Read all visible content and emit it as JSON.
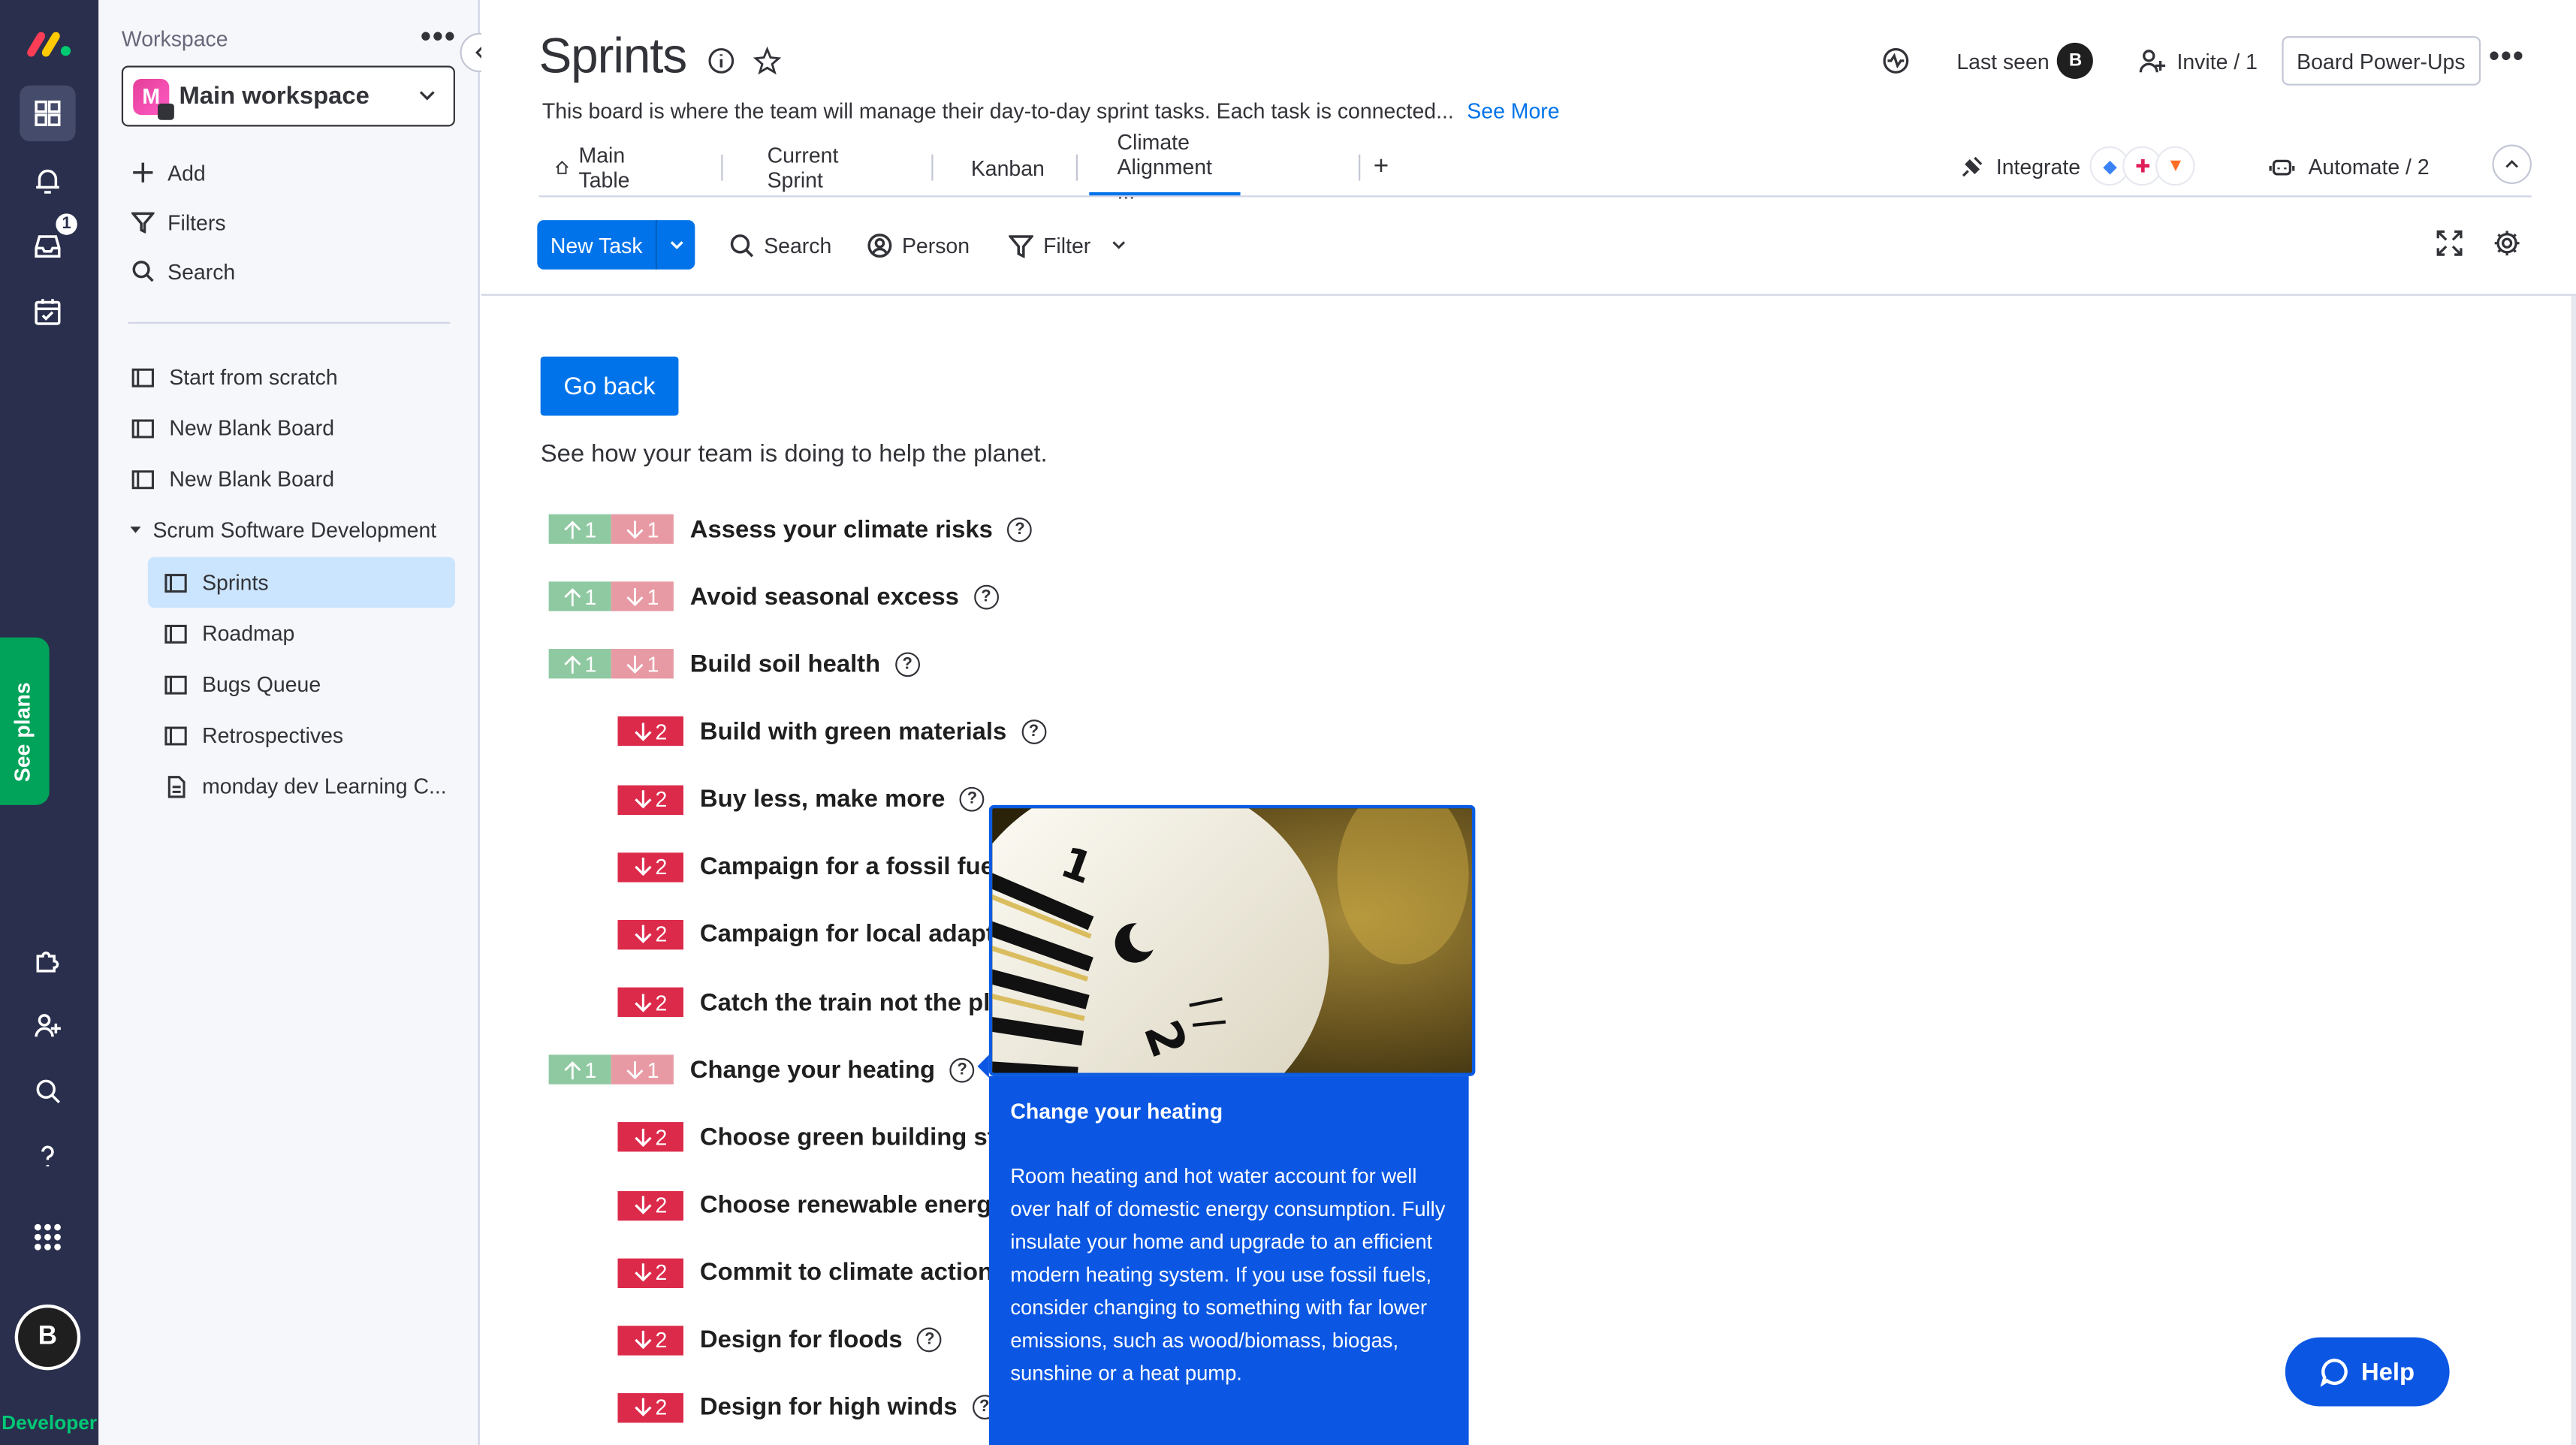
{
  "rail": {
    "inbox_badge": "1",
    "see_plans": "See plans",
    "avatar_initial": "B",
    "developer": "Developer"
  },
  "workspace": {
    "label": "Workspace",
    "name": "Main workspace",
    "icon_letter": "M",
    "actions": [
      "Add",
      "Filters",
      "Search"
    ],
    "items": [
      "Start from scratch",
      "New Blank Board",
      "New Blank Board"
    ],
    "folder": "Scrum Software Development",
    "folder_items": [
      "Sprints",
      "Roadmap",
      "Bugs Queue",
      "Retrospectives",
      "monday dev Learning C..."
    ]
  },
  "header": {
    "title": "Sprints",
    "description": "This board is where the team will manage their day-to-day sprint tasks. Each task is connected...",
    "see_more": "See More",
    "last_seen": "Last seen",
    "last_seen_avatar": "B",
    "invite": "Invite / 1",
    "power_ups": "Board Power-Ups"
  },
  "tabs": [
    "Main Table",
    "Current Sprint",
    "Kanban",
    "Climate Alignment ..."
  ],
  "integrate": "Integrate",
  "automate": "Automate / 2",
  "toolbar": {
    "new_task": "New Task",
    "search": "Search",
    "person": "Person",
    "filter": "Filter"
  },
  "app": {
    "go_back": "Go back",
    "intro": "See how your team is doing to help the planet.",
    "rows": [
      {
        "title": "Assess your climate risks",
        "type": "both",
        "up": "1",
        "down": "1"
      },
      {
        "title": "Avoid seasonal excess",
        "type": "both",
        "up": "1",
        "down": "1"
      },
      {
        "title": "Build soil health",
        "type": "both",
        "up": "1",
        "down": "1"
      },
      {
        "title": "Build with green materials",
        "type": "down",
        "down": "2"
      },
      {
        "title": "Buy less, make more",
        "type": "down",
        "down": "2"
      },
      {
        "title": "Campaign for a fossil fue",
        "type": "down",
        "down": "2"
      },
      {
        "title": "Campaign for local adapt",
        "type": "down",
        "down": "2"
      },
      {
        "title": "Catch the train not the pl",
        "type": "down",
        "down": "2"
      },
      {
        "title": "Change your heating",
        "type": "both",
        "up": "1",
        "down": "1"
      },
      {
        "title": "Choose green building st",
        "type": "down",
        "down": "2"
      },
      {
        "title": "Choose renewable energ",
        "type": "down",
        "down": "2"
      },
      {
        "title": "Commit to climate action",
        "type": "down",
        "down": "2"
      },
      {
        "title": "Design for floods",
        "type": "down",
        "down": "2"
      },
      {
        "title": "Design for high winds",
        "type": "down",
        "down": "2"
      }
    ],
    "popup": {
      "title": "Change your heating",
      "text": "Room heating and hot water account for well over half of domestic energy consumption. Fully insulate your home and upgrade to an efficient modern heating system. If you use fossil fuels, consider changing to something with far lower emissions, such as wood/biomass, biogas, sunshine or a heat pump."
    }
  },
  "help": "Help"
}
